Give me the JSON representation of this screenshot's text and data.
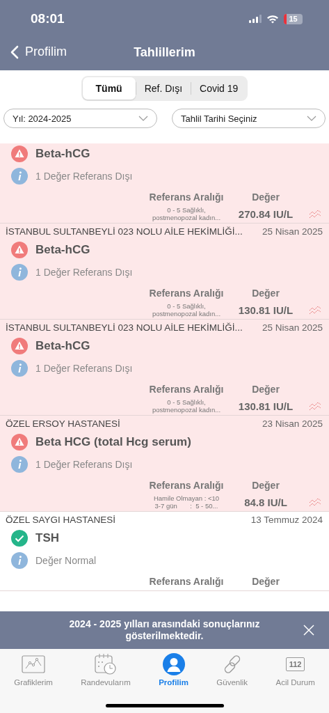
{
  "status_bar": {
    "time": "08:01",
    "battery": "15"
  },
  "nav": {
    "back": "Profilim",
    "title": "Tahlillerim"
  },
  "segments": [
    {
      "label": "Tümü",
      "selected": true
    },
    {
      "label": "Ref. Dışı",
      "selected": false
    },
    {
      "label": "Covid 19",
      "selected": false
    }
  ],
  "filters": [
    {
      "value": "Yıl: 2024-2025"
    },
    {
      "value": "Tahlil Tarihi Seçiniz"
    }
  ],
  "results": [
    {
      "kind": "abnormal",
      "name": "Beta-hCG",
      "note": "1 Değer Referans Dışı",
      "ref_header": "Referans Aralığı",
      "value_header": "Değer",
      "ref_lines": [
        "0 - 5 Sağlıklı,",
        "postmenopozal kadın..."
      ],
      "value": "270.84 IU/L"
    },
    {
      "lab": "İSTANBUL SULTANBEYLİ 023 NOLU AİLE HEKİMLİĞİ...",
      "date": "25 Nisan 2025",
      "kind": "abnormal",
      "name": "Beta-hCG",
      "note": "1 Değer Referans Dışı",
      "ref_header": "Referans Aralığı",
      "value_header": "Değer",
      "ref_lines": [
        "0 - 5 Sağlıklı,",
        "postmenopozal kadın..."
      ],
      "value": "130.81 IU/L"
    },
    {
      "lab": "İSTANBUL SULTANBEYLİ 023 NOLU AİLE HEKİMLİĞİ...",
      "date": "25 Nisan 2025",
      "kind": "abnormal",
      "name": "Beta-hCG",
      "note": "1 Değer Referans Dışı",
      "ref_header": "Referans Aralığı",
      "value_header": "Değer",
      "ref_lines": [
        "0 - 5 Sağlıklı,",
        "postmenopozal kadın..."
      ],
      "value": "130.81 IU/L"
    },
    {
      "lab": "ÖZEL ERSOY HASTANESİ",
      "date": "23 Nisan 2025",
      "kind": "abnormal",
      "name": "Beta HCG (total Hcg serum)",
      "note": "1 Değer Referans Dışı",
      "ref_header": "Referans Aralığı",
      "value_header": "Değer",
      "ref_lines": [
        "Hamile Olmayan : <10",
        "3-7 gün       :  5 - 50..."
      ],
      "value": "84.8 IU/L"
    },
    {
      "lab": "ÖZEL SAYGI HASTANESİ",
      "date": "13 Temmuz 2024",
      "kind": "normal",
      "name": "TSH",
      "note": "Değer Normal",
      "ref_header": "Referans Aralığı",
      "value_header": "Değer"
    }
  ],
  "banner": {
    "message": "2024 - 2025 yılları arasındaki sonuçlarınız gösterilmektedir."
  },
  "tab_bar": [
    {
      "kind": "chart",
      "label": "Grafiklerim",
      "selected": false
    },
    {
      "kind": "calendar",
      "label": "Randevularım",
      "selected": false
    },
    {
      "kind": "profile",
      "label": "Profilim",
      "selected": true
    },
    {
      "kind": "link",
      "label": "Güvenlik",
      "selected": false
    },
    {
      "kind": "emergency",
      "label": "Acil Durum",
      "badge": "112",
      "selected": false
    }
  ]
}
